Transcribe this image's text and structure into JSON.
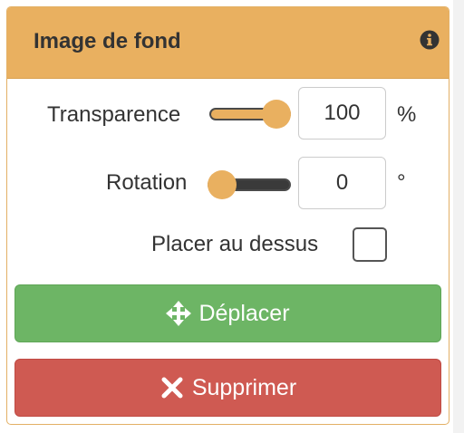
{
  "panel": {
    "title": "Image de fond",
    "info_icon": "info-circle-icon",
    "accent_color": "#e9b060"
  },
  "transparency": {
    "label": "Transparence",
    "value": "100",
    "unit": "%",
    "slider_level": 1.0
  },
  "rotation": {
    "label": "Rotation",
    "value": "0",
    "unit": "°",
    "slider_level": 0.0
  },
  "on_top": {
    "label": "Placer au dessus",
    "checked": false
  },
  "buttons": {
    "move": {
      "label": "Déplacer",
      "icon": "arrows-move-icon",
      "color": "#6db565"
    },
    "delete": {
      "label": "Supprimer",
      "icon": "close-x-icon",
      "color": "#cf5a52"
    }
  }
}
